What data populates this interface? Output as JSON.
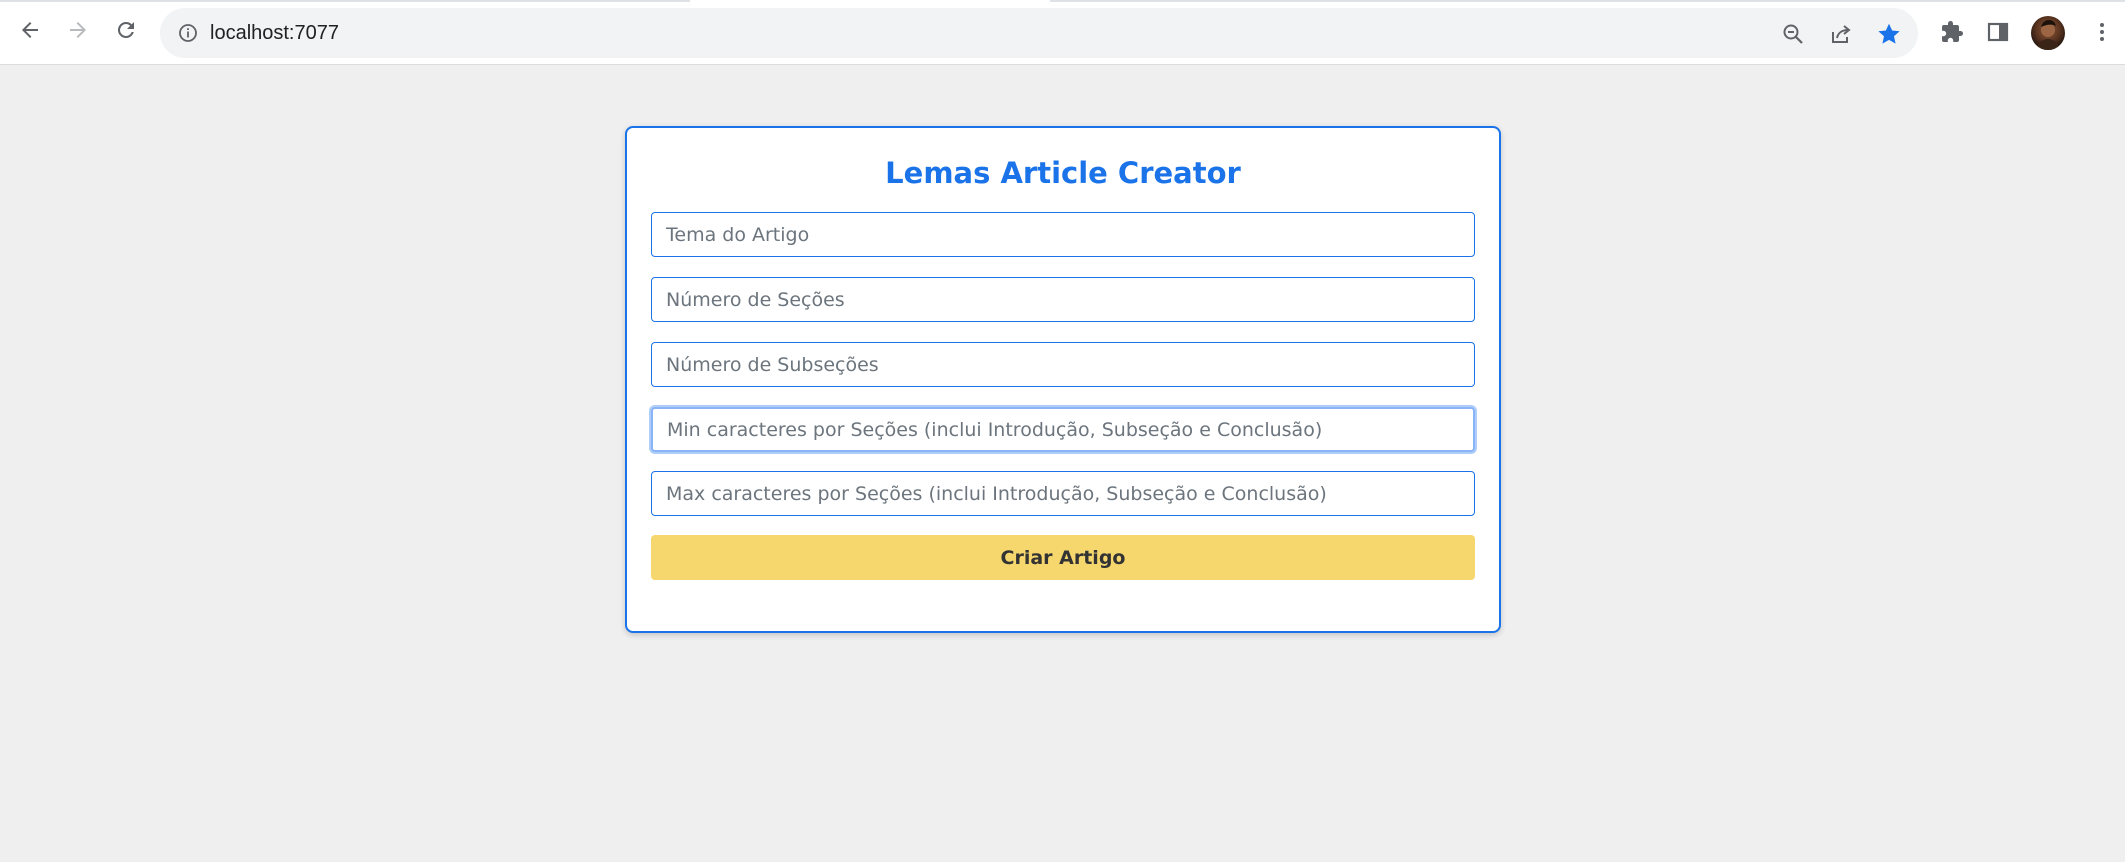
{
  "browser": {
    "url": "localhost:7077"
  },
  "form": {
    "title": "Lemas Article Creator",
    "fields": [
      {
        "placeholder": "Tema do Artigo",
        "value": ""
      },
      {
        "placeholder": "Número de Seções",
        "value": ""
      },
      {
        "placeholder": "Número de Subseções",
        "value": ""
      },
      {
        "placeholder": "Min caracteres por Seções (inclui Introdução, Subseção e Conclusão)",
        "value": ""
      },
      {
        "placeholder": "Max caracteres por Seções (inclui Introdução, Subseção e Conclusão)",
        "value": ""
      }
    ],
    "submit_label": "Criar Artigo"
  },
  "colors": {
    "accent": "#1a73e8",
    "button": "#f5d76e",
    "page_bg": "#efefef",
    "bookmark_star": "#1a73e8"
  },
  "icons": {
    "back": "arrow-left-icon",
    "forward": "arrow-right-icon",
    "reload": "reload-icon",
    "site_info": "info-icon",
    "zoom": "zoom-out-icon",
    "share": "share-icon",
    "bookmark": "star-icon",
    "extensions": "puzzle-icon",
    "side_panel": "side-panel-icon",
    "menu": "kebab-menu-icon"
  }
}
